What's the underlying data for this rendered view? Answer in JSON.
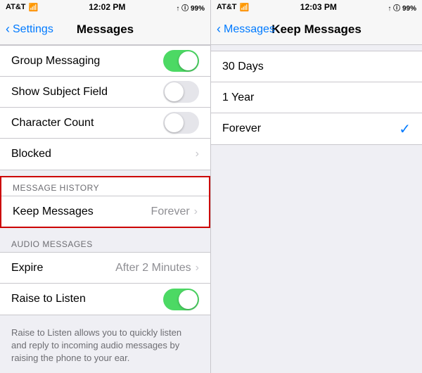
{
  "left": {
    "statusBar": {
      "carrier": "AT&T",
      "wifi": "WiFi",
      "time": "12:02 PM",
      "signal": "▲ ① 99%"
    },
    "navBar": {
      "backLabel": "Settings",
      "title": "Messages"
    },
    "rows": [
      {
        "id": "group-messaging",
        "label": "Group Messaging",
        "control": "toggle-on"
      },
      {
        "id": "show-subject-field",
        "label": "Show Subject Field",
        "control": "toggle-off"
      },
      {
        "id": "character-count",
        "label": "Character Count",
        "control": "toggle-off"
      },
      {
        "id": "blocked",
        "label": "Blocked",
        "control": "chevron"
      }
    ],
    "messageHistorySection": {
      "header": "MESSAGE HISTORY",
      "rows": [
        {
          "id": "keep-messages",
          "label": "Keep Messages",
          "value": "Forever",
          "control": "chevron"
        }
      ]
    },
    "audioMessagesSection": {
      "header": "AUDIO MESSAGES",
      "rows": [
        {
          "id": "expire",
          "label": "Expire",
          "value": "After 2 Minutes",
          "control": "chevron"
        },
        {
          "id": "raise-to-listen",
          "label": "Raise to Listen",
          "control": "toggle-on"
        }
      ]
    },
    "footer": "Raise to Listen allows you to quickly listen and reply to incoming audio messages by raising the phone to your ear."
  },
  "right": {
    "statusBar": {
      "carrier": "AT&T",
      "wifi": "WiFi",
      "time": "12:03 PM",
      "signal": "▲ ① 99%"
    },
    "navBar": {
      "backLabel": "Messages",
      "title": "Keep Messages"
    },
    "options": [
      {
        "id": "30-days",
        "label": "30 Days",
        "selected": false
      },
      {
        "id": "1-year",
        "label": "1 Year",
        "selected": false
      },
      {
        "id": "forever",
        "label": "Forever",
        "selected": true
      }
    ]
  }
}
